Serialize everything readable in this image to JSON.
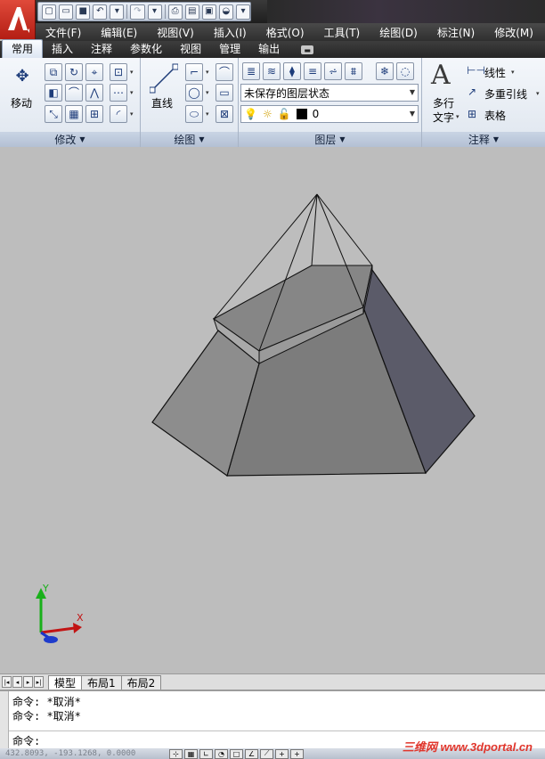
{
  "menu": [
    "文件(F)",
    "编辑(E)",
    "视图(V)",
    "插入(I)",
    "格式(O)",
    "工具(T)",
    "绘图(D)",
    "标注(N)",
    "修改(M)"
  ],
  "ribbon_tabs": [
    "常用",
    "插入",
    "注释",
    "参数化",
    "视图",
    "管理",
    "输出"
  ],
  "panels": {
    "modify": {
      "title": "修改",
      "move_label": "移动"
    },
    "draw": {
      "title": "绘图",
      "line_label": "直线"
    },
    "layers": {
      "title": "图层",
      "state_combo": "未保存的图层状态",
      "layer_combo": "0"
    },
    "annotation": {
      "title": "注释",
      "mtext_label_1": "多行",
      "mtext_label_2": "文字",
      "linear": "线性",
      "mleader": "多重引线",
      "table": "表格"
    }
  },
  "ucs": {
    "x_label": "X",
    "y_label": "Y"
  },
  "layout_tabs": [
    "模型",
    "布局1",
    "布局2"
  ],
  "command": {
    "history": [
      "命令: *取消*",
      "命令: *取消*"
    ],
    "prompt": "命令:"
  },
  "status": {
    "coords": "432.8093, -193.1268, 0.0000"
  },
  "watermark": "三维网 www.3dportal.cn",
  "colors": {
    "app_red": "#c62a1e",
    "ribbon_bg": "#e8edf4",
    "canvas": "#bdbdbd"
  }
}
